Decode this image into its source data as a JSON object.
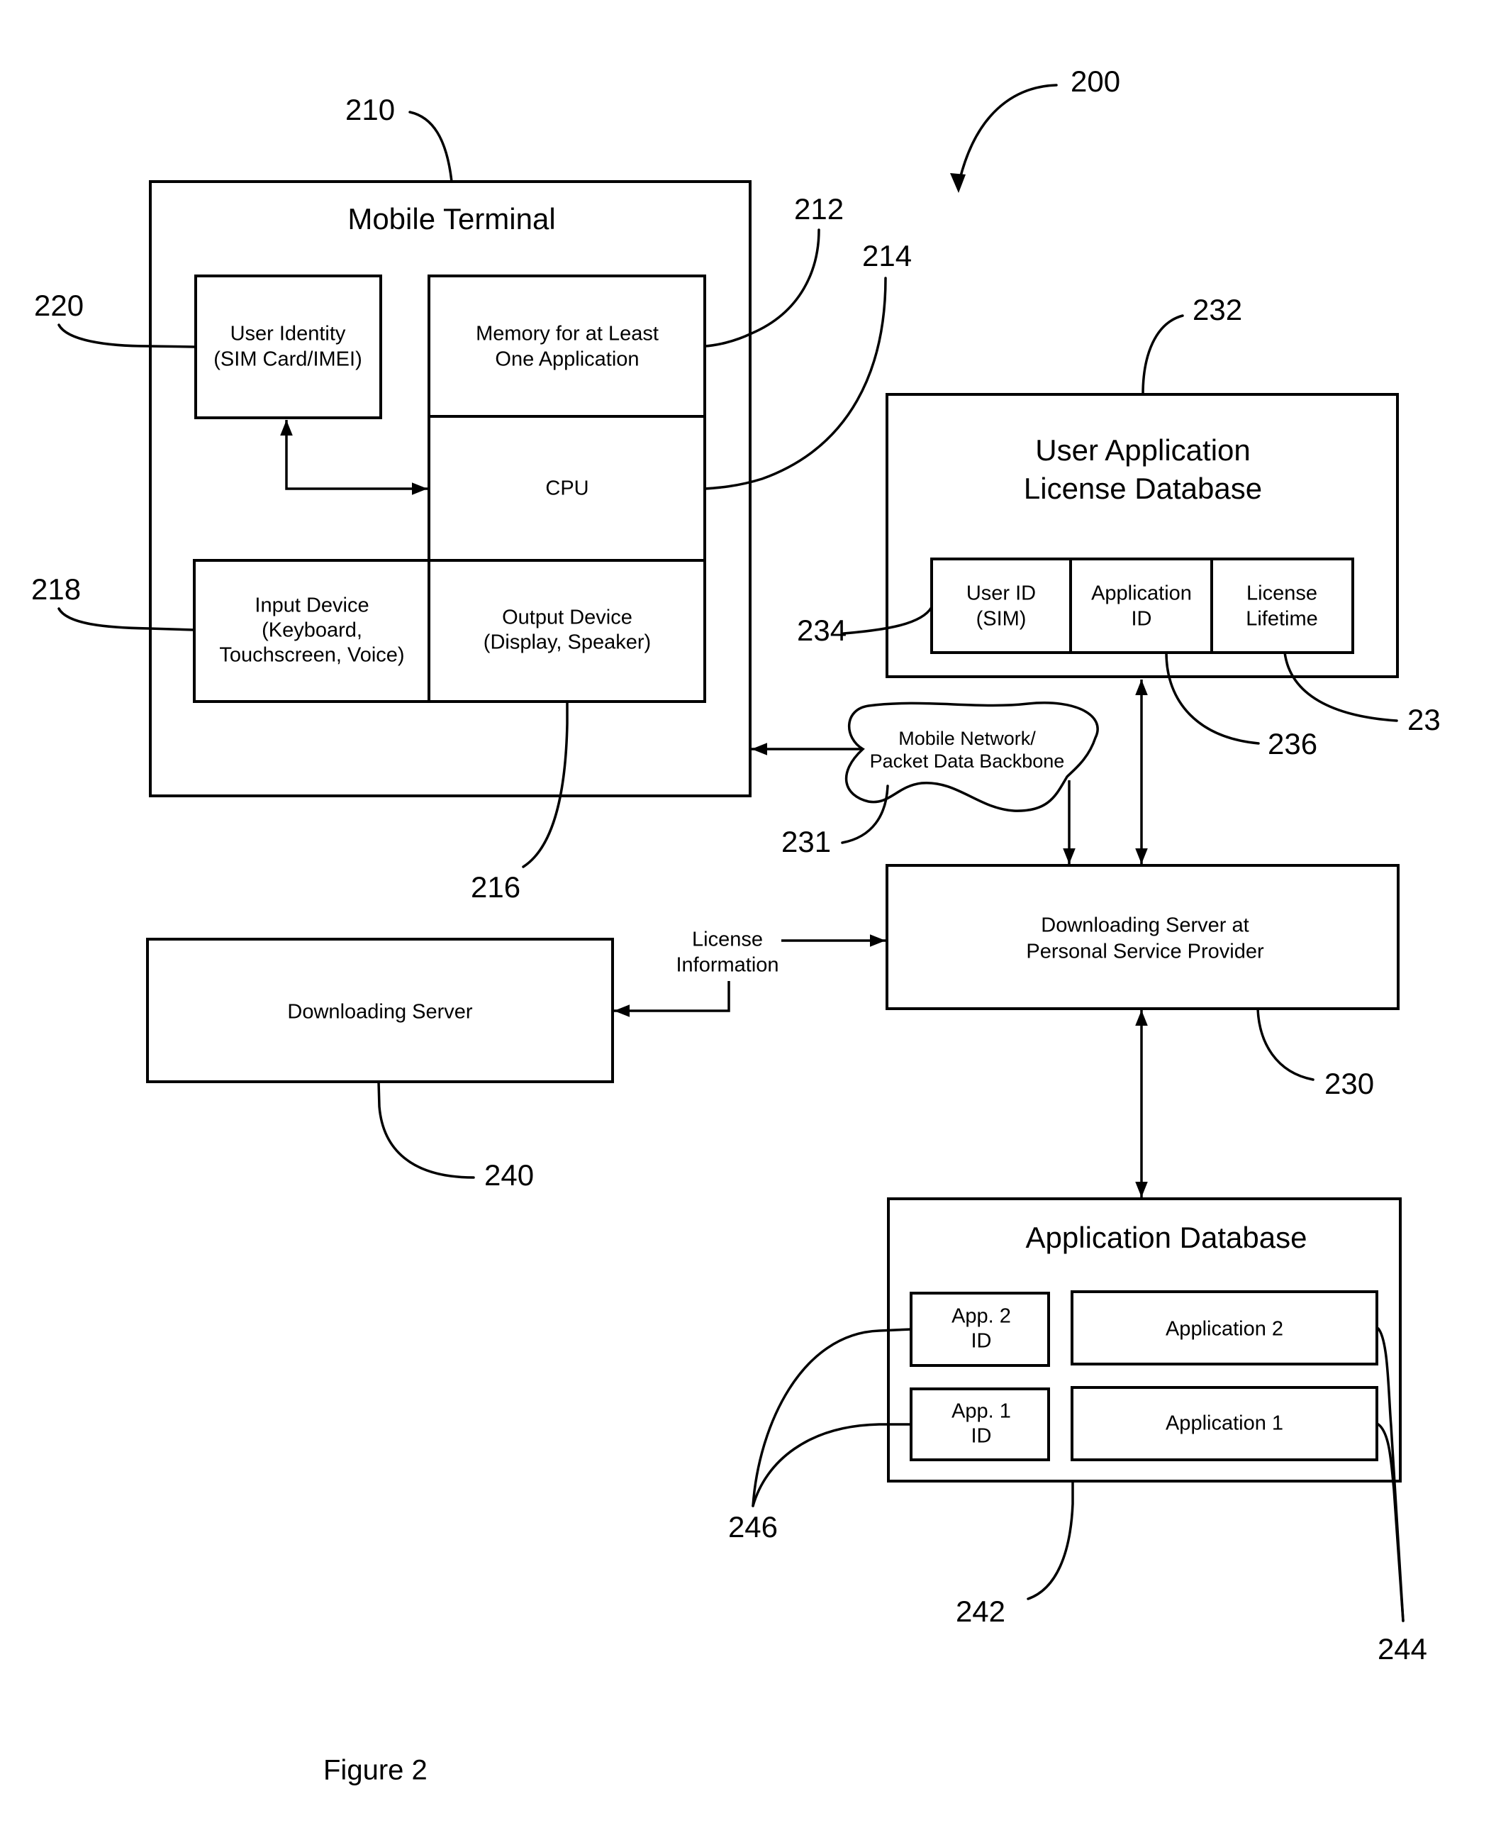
{
  "figure": {
    "caption": "Figure 2",
    "overall_ref": "200"
  },
  "mobile_terminal": {
    "ref": "210",
    "title": "Mobile Terminal",
    "user_identity": {
      "ref": "220",
      "lines": [
        "User Identity",
        "(SIM Card/IMEI)"
      ]
    },
    "memory": {
      "ref": "212",
      "lines": [
        "Memory for at Least",
        "One Application"
      ]
    },
    "cpu": {
      "ref": "214",
      "label": "CPU"
    },
    "input_device": {
      "ref": "218",
      "lines": [
        "Input Device",
        "(Keyboard,",
        "Touchscreen, Voice)"
      ]
    },
    "output_device": {
      "ref": "216",
      "lines": [
        "Output Device",
        "(Display, Speaker)"
      ]
    }
  },
  "license_database": {
    "ref": "232",
    "title_lines": [
      "User Application",
      "License Database"
    ],
    "columns": [
      {
        "ref": "234",
        "lines": [
          "User ID",
          "(SIM)"
        ]
      },
      {
        "ref": "236",
        "lines": [
          "Application",
          "ID"
        ]
      },
      {
        "ref": "23",
        "lines": [
          "License",
          "Lifetime"
        ]
      }
    ]
  },
  "network": {
    "ref": "231",
    "lines": [
      "Mobile Network/",
      "Packet Data Backbone"
    ]
  },
  "psp_server": {
    "ref": "230",
    "lines": [
      "Downloading Server at",
      "Personal Service Provider"
    ]
  },
  "downloading_server": {
    "ref": "240",
    "label": "Downloading Server"
  },
  "license_info": {
    "lines": [
      "License",
      "Information"
    ]
  },
  "application_database": {
    "ref": "242",
    "title": "Application Database",
    "id_ref": "246",
    "app_ref": "244",
    "rows": [
      {
        "id_lines": [
          "App. 2",
          "ID"
        ],
        "app": "Application 2"
      },
      {
        "id_lines": [
          "App. 1",
          "ID"
        ],
        "app": "Application 1"
      }
    ]
  }
}
